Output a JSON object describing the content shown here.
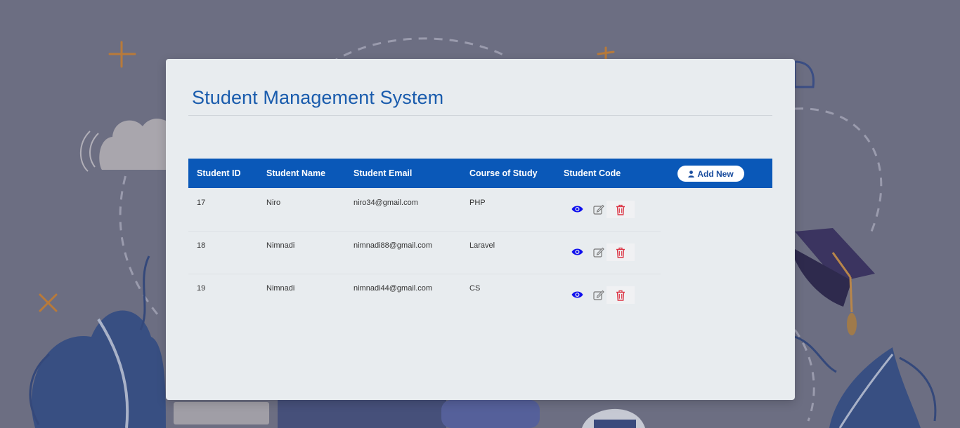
{
  "page": {
    "title": "Student Management System"
  },
  "table": {
    "headers": [
      "Student ID",
      "Student Name",
      "Student Email",
      "Course of Study",
      "Student Code"
    ],
    "add_new_label": "Add New",
    "rows": [
      {
        "id": "17",
        "name": "Niro",
        "email": "niro34@gmail.com",
        "course": "PHP"
      },
      {
        "id": "18",
        "name": "Nimnadi",
        "email": "nimnadi88@gmail.com",
        "course": "Laravel"
      },
      {
        "id": "19",
        "name": "Nimnadi",
        "email": "nimnadi44@gmail.com",
        "course": "CS"
      }
    ],
    "row_actions": [
      "eye-icon",
      "edit-icon",
      "trash-icon"
    ]
  },
  "colors": {
    "background": "#6c6e82",
    "accent": "#0a58b8",
    "title": "#1a5cad",
    "view_icon": "#1010ee",
    "delete_icon": "#dc3545"
  }
}
